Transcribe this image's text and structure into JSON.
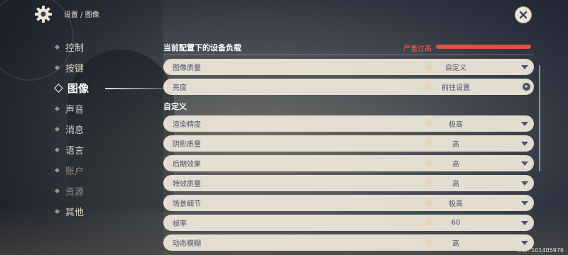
{
  "breadcrumb": "设置 / 图像",
  "nav": {
    "items": [
      {
        "label": "控制",
        "state": "normal"
      },
      {
        "label": "按键",
        "state": "normal"
      },
      {
        "label": "图像",
        "state": "active"
      },
      {
        "label": "声音",
        "state": "normal"
      },
      {
        "label": "消息",
        "state": "normal"
      },
      {
        "label": "语言",
        "state": "normal"
      },
      {
        "label": "账户",
        "state": "dim"
      },
      {
        "label": "资源",
        "state": "dim"
      },
      {
        "label": "其他",
        "state": "normal"
      }
    ]
  },
  "load": {
    "title": "当前配置下的设备负载",
    "status": "严重过高",
    "level": 1.0,
    "color": "#e0533f"
  },
  "top_rows": [
    {
      "label": "图像质量",
      "value": "自定义",
      "control": "dropdown"
    },
    {
      "label": "亮度",
      "value": "前往设置",
      "control": "link"
    }
  ],
  "custom_section": {
    "title": "自定义",
    "rows": [
      {
        "label": "渲染精度",
        "value": "极高"
      },
      {
        "label": "阴影质量",
        "value": "高"
      },
      {
        "label": "后期效果",
        "value": "高"
      },
      {
        "label": "特效质量",
        "value": "高"
      },
      {
        "label": "场景细节",
        "value": "极高"
      },
      {
        "label": "帧率",
        "value": "60"
      },
      {
        "label": "动态模糊",
        "value": "高"
      }
    ]
  },
  "uid": "UID: 101405976",
  "icons": {
    "settings": "gear-icon",
    "close": "close-icon"
  }
}
